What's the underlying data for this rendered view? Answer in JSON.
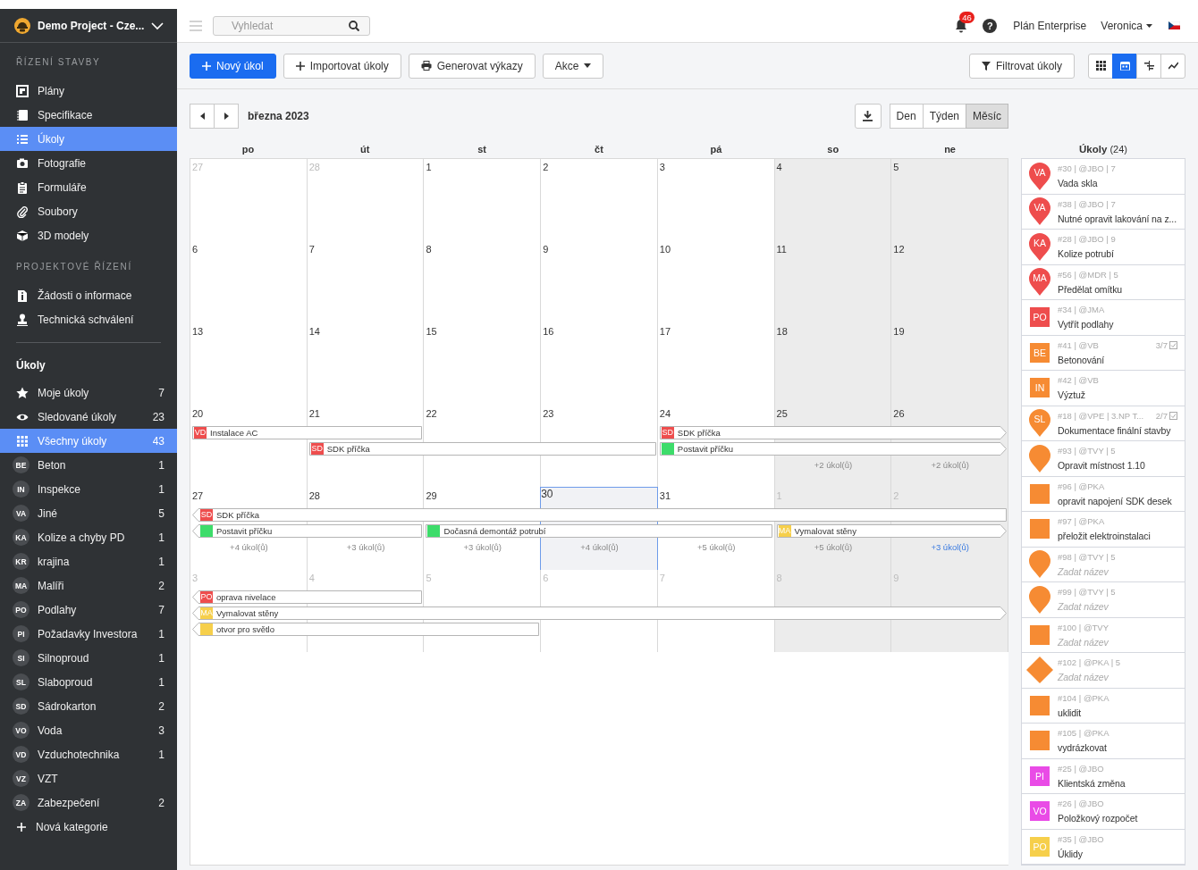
{
  "sidebar": {
    "project": "Demo Project - Cze...",
    "sections": [
      {
        "title": "ŘÍZENÍ STAVBY",
        "items": [
          {
            "label": "Plány",
            "selected": false
          },
          {
            "label": "Specifikace",
            "selected": false
          },
          {
            "label": "Úkoly",
            "selected": true
          },
          {
            "label": "Fotografie",
            "selected": false
          },
          {
            "label": "Formuláře",
            "selected": false
          },
          {
            "label": "Soubory",
            "selected": false
          },
          {
            "label": "3D modely",
            "selected": false
          }
        ]
      },
      {
        "title": "PROJEKTOVÉ ŘÍZENÍ",
        "items": [
          {
            "label": "Žádosti o informace",
            "selected": false
          },
          {
            "label": "Technická schválení",
            "selected": false
          }
        ]
      }
    ],
    "tasks": {
      "title": "Úkoly",
      "filters": [
        {
          "label": "Moje úkoly",
          "count": "7",
          "selected": false
        },
        {
          "label": "Sledované úkoly",
          "count": "23",
          "selected": false
        },
        {
          "label": "Všechny úkoly",
          "count": "43",
          "selected": true
        }
      ],
      "categories": [
        {
          "abbr": "BE",
          "label": "Beton",
          "count": "1",
          "selected": false
        },
        {
          "abbr": "IN",
          "label": "Inspekce",
          "count": "1",
          "selected": false
        },
        {
          "abbr": "VA",
          "label": "Jiné",
          "count": "5",
          "selected": false
        },
        {
          "abbr": "KA",
          "label": "Kolize a chyby PD",
          "count": "1",
          "selected": false
        },
        {
          "abbr": "KR",
          "label": "krajina",
          "count": "1",
          "selected": false
        },
        {
          "abbr": "MA",
          "label": "Malíři",
          "count": "2",
          "selected": false
        },
        {
          "abbr": "PO",
          "label": "Podlahy",
          "count": "7",
          "selected": false
        },
        {
          "abbr": "PI",
          "label": "Požadavky Investora",
          "count": "1",
          "selected": false
        },
        {
          "abbr": "SI",
          "label": "Silnoproud",
          "count": "1",
          "selected": false
        },
        {
          "abbr": "SL",
          "label": "Slaboproud",
          "count": "1",
          "selected": false
        },
        {
          "abbr": "SD",
          "label": "Sádrokarton",
          "count": "2",
          "selected": false
        },
        {
          "abbr": "VO",
          "label": "Voda",
          "count": "3",
          "selected": false
        },
        {
          "abbr": "VD",
          "label": "Vzduchotechnika",
          "count": "1",
          "selected": false
        },
        {
          "abbr": "VZ",
          "label": "VZT",
          "selected": false
        },
        {
          "abbr": "ZA",
          "label": "Zabezpečení",
          "count": "2",
          "selected": false
        }
      ],
      "add": "Nová kategorie"
    }
  },
  "topbar": {
    "search": {
      "placeholder": "Vyhledat"
    },
    "notifications": "46",
    "help": "?",
    "plan": "Plán Enterprise",
    "user": "Veronica"
  },
  "toolbar": {
    "buttons": [
      {
        "label": "Nový úkol",
        "kind": "primary"
      },
      {
        "label": "Importovat úkoly",
        "kind": "add"
      },
      {
        "label": "Generovat výkazy",
        "kind": "print"
      },
      {
        "label": "Akce",
        "kind": "dropdown"
      }
    ],
    "filter": "Filtrovat úkoly",
    "views": [
      {
        "selected": false
      },
      {
        "selected": true
      },
      {
        "selected": false
      },
      {
        "selected": false
      }
    ]
  },
  "calendar": {
    "title": "března 2023",
    "modes": [
      {
        "label": "Den",
        "selected": false
      },
      {
        "label": "Týden",
        "selected": false
      },
      {
        "label": "Měsíc",
        "selected": true
      }
    ],
    "weekdays": [
      "po",
      "út",
      "st",
      "čt",
      "pá",
      "so",
      "ne"
    ],
    "weeks": [
      {
        "days": [
          {
            "label": "27",
            "other_month": true,
            "today": false
          },
          {
            "label": "28",
            "other_month": true,
            "today": false
          },
          {
            "label": "1",
            "other_month": false,
            "today": false
          },
          {
            "label": "2",
            "other_month": false,
            "today": false
          },
          {
            "label": "3",
            "other_month": false,
            "today": false
          },
          {
            "label": "4",
            "other_month": false,
            "today": false
          },
          {
            "label": "5",
            "other_month": false,
            "today": false
          }
        ]
      },
      {
        "days": [
          {
            "label": "6",
            "other_month": false,
            "today": false
          },
          {
            "label": "7",
            "other_month": false,
            "today": false
          },
          {
            "label": "8",
            "other_month": false,
            "today": false
          },
          {
            "label": "9",
            "other_month": false,
            "today": false
          },
          {
            "label": "10",
            "other_month": false,
            "today": false
          },
          {
            "label": "11",
            "other_month": false,
            "today": false
          },
          {
            "label": "12",
            "other_month": false,
            "today": false
          }
        ]
      },
      {
        "days": [
          {
            "label": "13",
            "other_month": false,
            "today": false
          },
          {
            "label": "14",
            "other_month": false,
            "today": false
          },
          {
            "label": "15",
            "other_month": false,
            "today": false
          },
          {
            "label": "16",
            "other_month": false,
            "today": false
          },
          {
            "label": "17",
            "other_month": false,
            "today": false
          },
          {
            "label": "18",
            "other_month": false,
            "today": false
          },
          {
            "label": "19",
            "other_month": false,
            "today": false
          }
        ]
      },
      {
        "days": [
          {
            "label": "20",
            "other_month": false,
            "today": false
          },
          {
            "label": "21",
            "other_month": false,
            "today": false
          },
          {
            "label": "22",
            "other_month": false,
            "today": false
          },
          {
            "label": "23",
            "other_month": false,
            "today": false
          },
          {
            "label": "24",
            "other_month": false,
            "today": false
          },
          {
            "label": "25",
            "other_month": false,
            "today": false,
            "more": {
              "label": "+2 úkol(ů)",
              "hover": false
            }
          },
          {
            "label": "26",
            "other_month": false,
            "today": false,
            "more": {
              "label": "+2 úkol(ů)",
              "hover": false
            }
          }
        ],
        "events": [
          {
            "abbr": "VD",
            "color": "#ee4d4d",
            "title": "Instalace AC",
            "continues_left": false,
            "continues_right": false
          },
          {
            "abbr": "SD",
            "color": "#ee4d4d",
            "title": "SDK příčka",
            "continues_left": false,
            "continues_right": false
          },
          {
            "abbr": "SD",
            "color": "#ee4d4d",
            "title": "SDK příčka",
            "continues_left": false,
            "continues_right": true
          },
          {
            "color": "#3ddc6a",
            "title": "Postavit příčku",
            "continues_left": false,
            "continues_right": true
          }
        ]
      },
      {
        "days": [
          {
            "label": "27",
            "other_month": false,
            "today": false,
            "more": {
              "label": "+4 úkol(ů)",
              "hover": false
            }
          },
          {
            "label": "28",
            "other_month": false,
            "today": false,
            "more": {
              "label": "+3 úkol(ů)",
              "hover": false
            }
          },
          {
            "label": "29",
            "other_month": false,
            "today": false,
            "more": {
              "label": "+3 úkol(ů)",
              "hover": false
            }
          },
          {
            "label": "30",
            "other_month": false,
            "today": true,
            "more": {
              "label": "+4 úkol(ů)",
              "hover": false
            }
          },
          {
            "label": "31",
            "other_month": false,
            "today": false,
            "more": {
              "label": "+5 úkol(ů)",
              "hover": false
            }
          },
          {
            "label": "1",
            "other_month": true,
            "today": false,
            "more": {
              "label": "+5 úkol(ů)",
              "hover": false
            }
          },
          {
            "label": "2",
            "other_month": true,
            "today": false,
            "more": {
              "label": "+3 úkol(ů)",
              "hover": true
            }
          }
        ],
        "events": [
          {
            "abbr": "SD",
            "color": "#ee4d4d",
            "title": "SDK příčka",
            "continues_left": true,
            "continues_right": false
          },
          {
            "color": "#3ddc6a",
            "title": "Postavit příčku",
            "continues_left": true,
            "continues_right": false
          },
          {
            "color": "#3ddc6a",
            "title": "Dočasná demontáž potrubí",
            "continues_left": false,
            "continues_right": false
          },
          {
            "abbr": "MA",
            "color": "#f6cf4b",
            "title": "Vymalovat stěny",
            "continues_left": false,
            "continues_right": true
          }
        ]
      },
      {
        "days": [
          {
            "label": "3",
            "other_month": true,
            "today": false
          },
          {
            "label": "4",
            "other_month": true,
            "today": false
          },
          {
            "label": "5",
            "other_month": true,
            "today": false
          },
          {
            "label": "6",
            "other_month": true,
            "today": false
          },
          {
            "label": "7",
            "other_month": true,
            "today": false
          },
          {
            "label": "8",
            "other_month": true,
            "today": false
          },
          {
            "label": "9",
            "other_month": true,
            "today": false
          }
        ],
        "events": [
          {
            "abbr": "PO",
            "color": "#ee4d4d",
            "title": "oprava nivelace",
            "continues_left": true,
            "continues_right": false
          },
          {
            "abbr": "MA",
            "color": "#f6cf4b",
            "title": "Vymalovat stěny",
            "continues_left": true,
            "continues_right": true
          },
          {
            "color": "#f6cf4b",
            "title": "otvor pro světlo",
            "continues_left": true,
            "continues_right": false
          }
        ]
      }
    ]
  },
  "task_panel": {
    "title": "**Úkoly** (24)",
    "items": [
      {
        "kind": "pin",
        "color": "#ee4d4d",
        "abbr": "VA",
        "meta": "#30 | @JBO | 7",
        "title": "Vada skla"
      },
      {
        "kind": "pin",
        "color": "#ee4d4d",
        "abbr": "VA",
        "meta": "#38 | @JBO | 7",
        "title": "Nutné opravit lakování na z..."
      },
      {
        "kind": "pin",
        "color": "#ee4d4d",
        "abbr": "KA",
        "meta": "#28 | @JBO | 9",
        "title": "Kolize potrubí"
      },
      {
        "kind": "pin",
        "color": "#ee4d4d",
        "abbr": "MA",
        "meta": "#56 | @MDR | 5",
        "title": "Předělat omítku"
      },
      {
        "kind": "square",
        "color": "#ee4d4d",
        "abbr": "PO",
        "meta": "#34 | @JMA",
        "title": "Vytřít podlahy"
      },
      {
        "kind": "square",
        "color": "#f68b33",
        "abbr": "BE",
        "meta": "#41 | @VB",
        "progress": "3/7",
        "title": "Betonování"
      },
      {
        "kind": "square",
        "color": "#f68b33",
        "abbr": "IN",
        "meta": "#42 | @VB",
        "title": "Výztuž"
      },
      {
        "kind": "pin",
        "color": "#f68b33",
        "abbr": "SL",
        "meta": "#18 | @VPE | 3.NP T...",
        "progress": "2/7",
        "title": "Dokumentace finální stavby"
      },
      {
        "kind": "pin",
        "color": "#f68b33",
        "meta": "#93 | @TVY | 5",
        "title": "Opravit místnost 1.10"
      },
      {
        "kind": "square",
        "color": "#f68b33",
        "meta": "#96 | @PKA",
        "title": "opravit napojení SDK desek"
      },
      {
        "kind": "square",
        "color": "#f68b33",
        "meta": "#97 | @PKA",
        "title": "přeložit elektroinstalaci"
      },
      {
        "kind": "pin",
        "color": "#f68b33",
        "meta": "#98 | @TVY | 5",
        "placeholder": "Zadat název"
      },
      {
        "kind": "pin",
        "color": "#f68b33",
        "meta": "#99 | @TVY | 5",
        "placeholder": "Zadat název"
      },
      {
        "kind": "square",
        "color": "#f68b33",
        "meta": "#100 | @TVY",
        "placeholder": "Zadat název"
      },
      {
        "kind": "diamond",
        "color": "#f68b33",
        "meta": "#102 | @PKA | 5",
        "placeholder": "Zadat název"
      },
      {
        "kind": "square",
        "color": "#f68b33",
        "meta": "#104 | @PKA",
        "title": "uklidit"
      },
      {
        "kind": "square",
        "color": "#f68b33",
        "meta": "#105 | @PKA",
        "title": "vydrázkovat"
      },
      {
        "kind": "square",
        "color": "#e94be6",
        "abbr": "PI",
        "meta": "#25 | @JBO",
        "title": "Klientská změna"
      },
      {
        "kind": "square",
        "color": "#e94be6",
        "abbr": "VO",
        "meta": "#26 | @JBO",
        "title": "Položkový rozpočet"
      },
      {
        "kind": "square",
        "color": "#f6cf4b",
        "abbr": "PO",
        "meta": "#35 | @JBO",
        "title": "Úklidy"
      }
    ]
  }
}
